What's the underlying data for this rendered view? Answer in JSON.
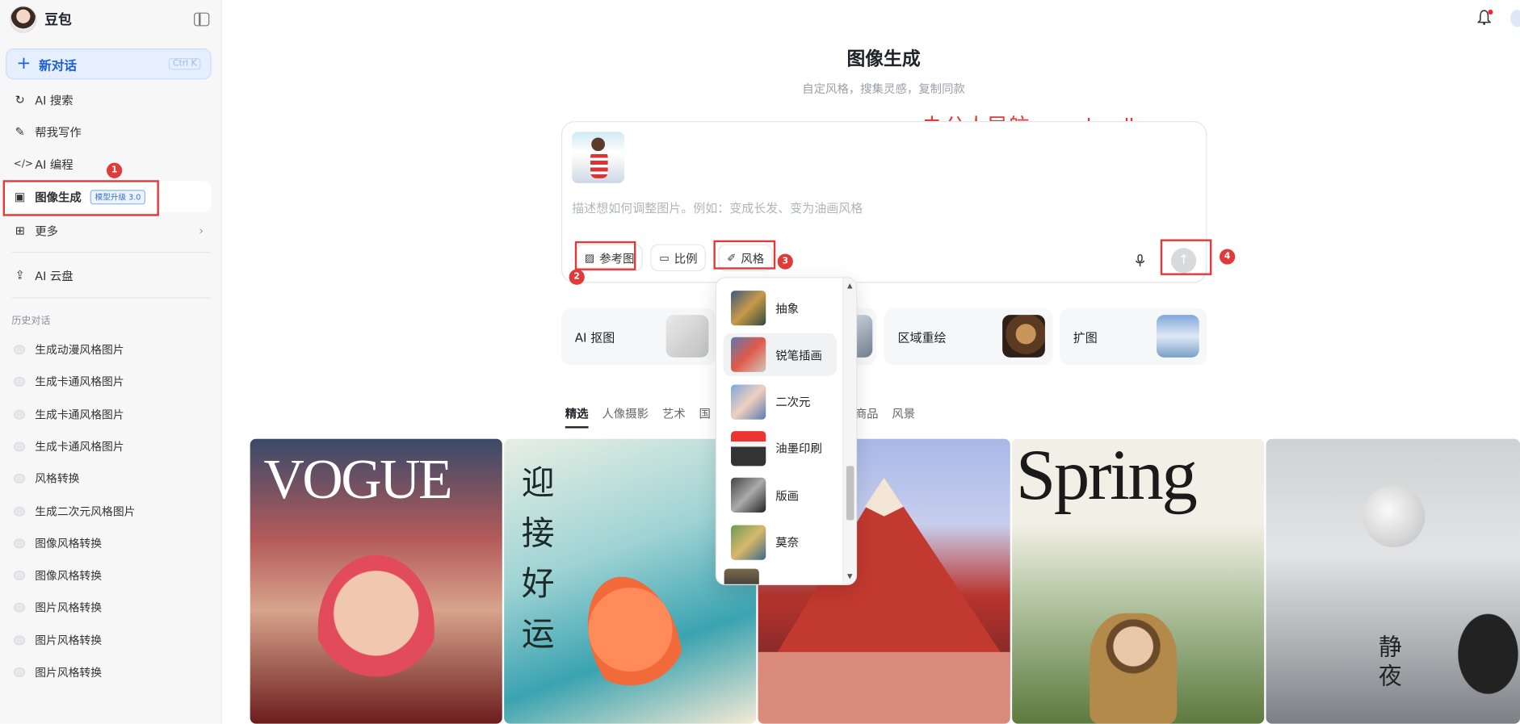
{
  "app": {
    "name": "豆包"
  },
  "sidebar": {
    "new_chat": {
      "label": "新对话",
      "shortcut": "Ctrl K"
    },
    "items": [
      {
        "label": "AI 搜索",
        "icon": "search-refresh-icon"
      },
      {
        "label": "帮我写作",
        "icon": "pen-icon"
      },
      {
        "label": "AI 编程",
        "icon": "code-icon"
      },
      {
        "label": "图像生成",
        "icon": "image-edit-icon",
        "badge": "模型升级 3.0"
      },
      {
        "label": "更多",
        "icon": "apps-icon"
      },
      {
        "label": "AI 云盘",
        "icon": "cloud-drive-icon"
      }
    ],
    "history_title": "历史对话",
    "history": [
      "生成动漫风格图片",
      "生成卡通风格图片",
      "生成卡通风格图片",
      "生成卡通风格图片",
      "风格转换",
      "生成二次元风格图片",
      "图像风格转换",
      "图像风格转换",
      "图片风格转换",
      "图片风格转换",
      "图片风格转换"
    ]
  },
  "main": {
    "title": "图像生成",
    "subtitle": "自定风格，搜集灵感，复制同款",
    "watermark": "办公人导航 www.bgrdh.com",
    "composer": {
      "placeholder": "描述想如何调整图片。例如：变成长发、变为油画风格",
      "chips": [
        "参考图",
        "比例",
        "风格"
      ]
    },
    "tools": [
      "AI 抠图",
      "区域重绘",
      "扩图"
    ],
    "tabs": [
      "精选",
      "人像摄影",
      "艺术",
      "国",
      "商品",
      "风景"
    ],
    "style_menu": [
      "抽象",
      "锐笔插画",
      "二次元",
      "油墨印刷",
      "版画",
      "莫奈"
    ],
    "gallery_text": {
      "vogue": "VOGUE",
      "spring": "Spring",
      "poster_cn": "迎接好运",
      "night": "静夜"
    }
  },
  "annotations": [
    "1",
    "2",
    "3",
    "4"
  ],
  "colors": {
    "accent": "#1f5fd6",
    "annotation": "#e03a3a",
    "watermark": "#e53935"
  }
}
